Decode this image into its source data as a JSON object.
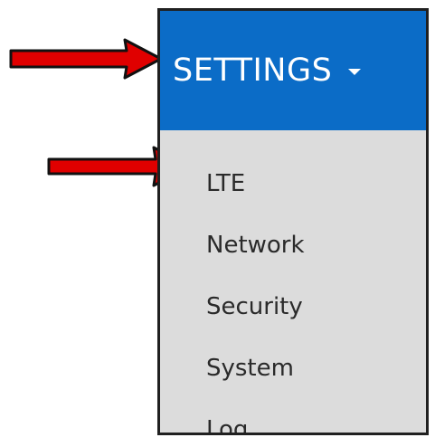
{
  "menu": {
    "title": "SETTINGS",
    "items": [
      {
        "label": "LTE"
      },
      {
        "label": "Network"
      },
      {
        "label": "Security"
      },
      {
        "label": "System"
      },
      {
        "label": "Log"
      }
    ]
  },
  "annotations": {
    "arrow_color": "#e00000",
    "arrow_outline": "#111111"
  },
  "colors": {
    "header_bg": "#0b6cc7",
    "menu_bg": "#dcdcdc",
    "border": "#202020"
  }
}
